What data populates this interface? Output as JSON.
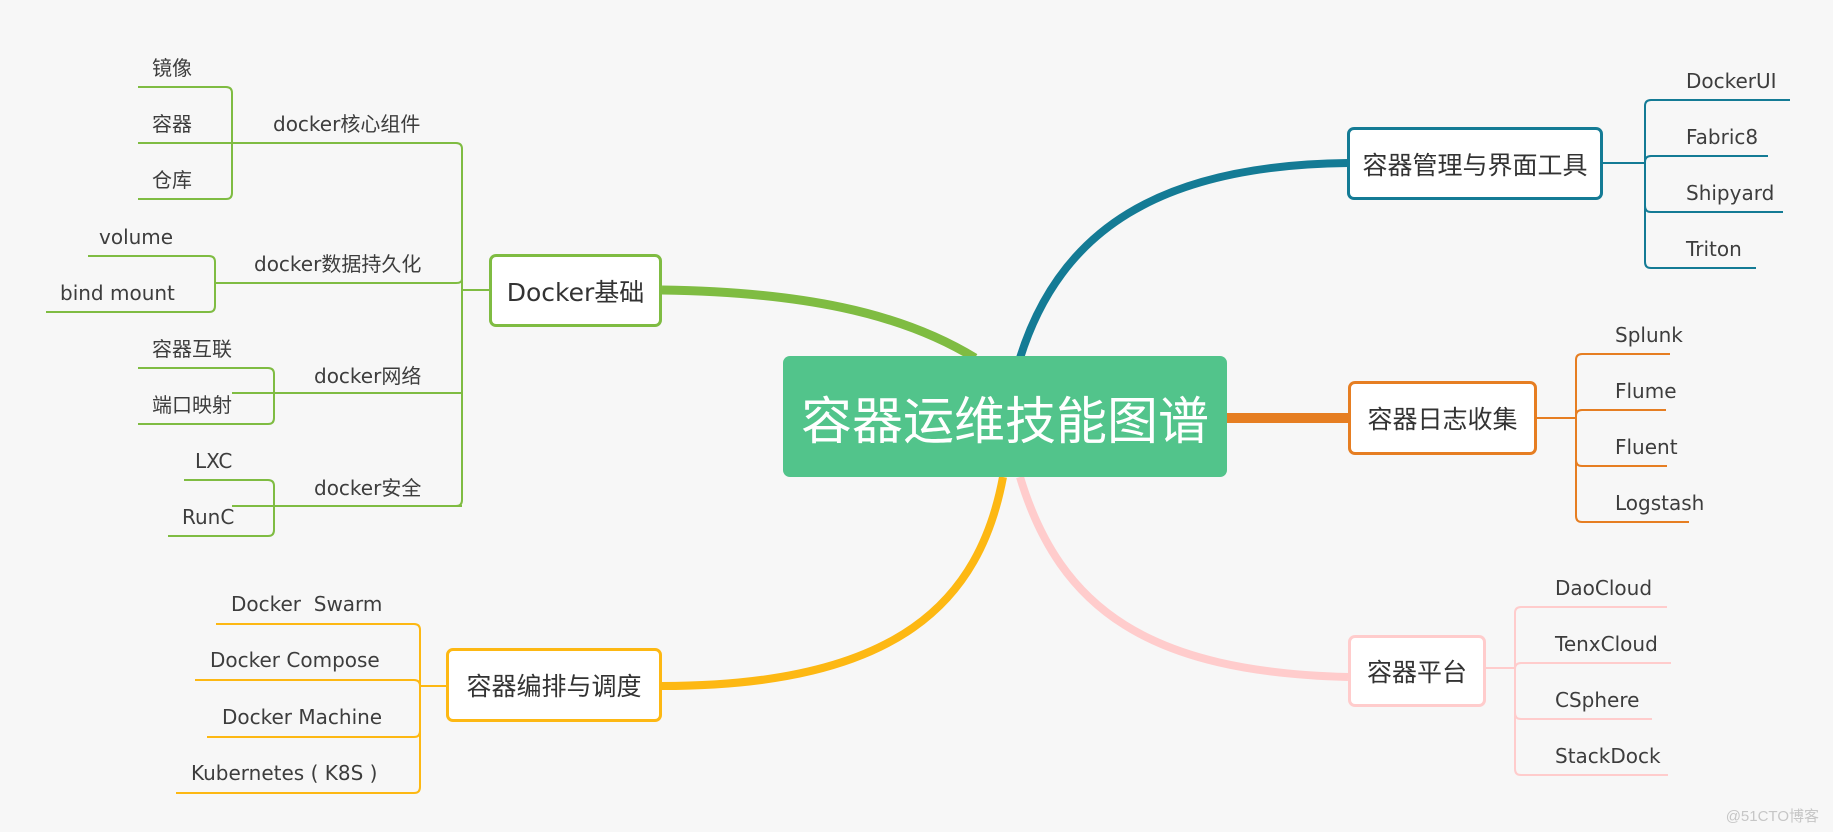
{
  "title": "容器运维技能图谱",
  "watermark": "@51CTO博客",
  "colors": {
    "background": "#f7f7f7",
    "root": "#52c48b",
    "docker_basics": "#7fbc42",
    "orchestration": "#fdb813",
    "management": "#147b95",
    "logging": "#e67e22",
    "platform": "#ffcccc",
    "text": "#3d3d3d"
  },
  "branches": {
    "docker_basics": {
      "label": "Docker基础",
      "groups": [
        {
          "label": "docker核心组件",
          "items": [
            "镜像",
            "容器",
            "仓库"
          ]
        },
        {
          "label": "docker数据持久化",
          "items": [
            "volume",
            "bind mount"
          ]
        },
        {
          "label": "docker网络",
          "items": [
            "容器互联",
            "端口映射"
          ]
        },
        {
          "label": "docker安全",
          "items": [
            "LXC",
            "RunC"
          ]
        }
      ]
    },
    "orchestration": {
      "label": "容器编排与调度",
      "items": [
        "Docker  Swarm",
        "Docker Compose",
        "Docker Machine",
        "Kubernetes ( K8S )"
      ]
    },
    "management": {
      "label": "容器管理与界面工具",
      "items": [
        "DockerUI",
        "Fabric8",
        "Shipyard",
        "Triton"
      ]
    },
    "logging": {
      "label": "容器日志收集",
      "items": [
        "Splunk",
        "Flume",
        "Fluent",
        "Logstash"
      ]
    },
    "platform": {
      "label": "容器平台",
      "items": [
        "DaoCloud",
        "TenxCloud",
        "CSphere",
        "StackDock"
      ]
    }
  }
}
